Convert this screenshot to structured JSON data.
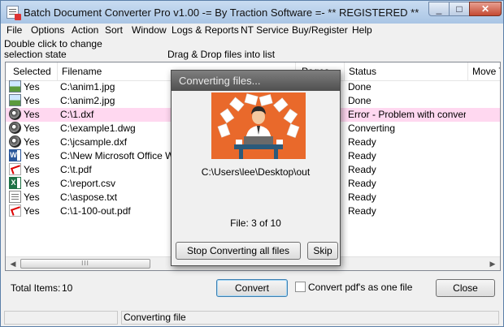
{
  "window": {
    "title": "Batch Document Converter Pro v1.00 -= By Traction Software =- ** REGISTERED **",
    "buttons": {
      "minimize": "_",
      "maximize": "□",
      "close": "✕"
    }
  },
  "menu": [
    "File",
    "Options",
    "Action",
    "Sort",
    "Window",
    "Logs & Reports",
    "NT Service",
    "Buy/Register",
    "Help"
  ],
  "hints": {
    "double_click_line1": "Double click to change",
    "double_click_line2": "selection state",
    "drag_drop": "Drag & Drop files into list"
  },
  "list": {
    "columns": [
      "Selected",
      "Filename",
      "Pages",
      "Status",
      "Move T"
    ],
    "rows": [
      {
        "icon": "image-file-icon",
        "selected": "Yes",
        "filename": "C:\\anim1.jpg",
        "status": "Done"
      },
      {
        "icon": "image-file-icon",
        "selected": "Yes",
        "filename": "C:\\anim2.jpg",
        "status": "Done"
      },
      {
        "icon": "cad-file-icon",
        "selected": "Yes",
        "filename": "C:\\1.dxf",
        "status": "Error - Problem with conver...",
        "error": true
      },
      {
        "icon": "cad-file-icon",
        "selected": "Yes",
        "filename": "C:\\example1.dwg",
        "status": "Converting"
      },
      {
        "icon": "cad-file-icon",
        "selected": "Yes",
        "filename": "C:\\jcsample.dxf",
        "status": "Ready"
      },
      {
        "icon": "word-file-icon",
        "selected": "Yes",
        "filename": "C:\\New Microsoft Office Wor",
        "status": "Ready"
      },
      {
        "icon": "pdf-file-icon",
        "selected": "Yes",
        "filename": "C:\\t.pdf",
        "status": "Ready"
      },
      {
        "icon": "excel-file-icon",
        "selected": "Yes",
        "filename": "C:\\report.csv",
        "status": "Ready"
      },
      {
        "icon": "text-file-icon",
        "selected": "Yes",
        "filename": "C:\\aspose.txt",
        "status": "Ready"
      },
      {
        "icon": "pdf-file-icon",
        "selected": "Yes",
        "filename": "C:\\1-100-out.pdf",
        "status": "Ready"
      }
    ],
    "scroll_thumb_grip": "III"
  },
  "footer": {
    "total_items_label": "Total Items:",
    "total_items_value": "10",
    "convert_button": "Convert",
    "convert_pdfs_label": "Convert pdf's as one file",
    "close_button": "Close"
  },
  "statusbar": {
    "panel1": "",
    "panel2": "Converting file"
  },
  "dialog": {
    "title": "Converting files...",
    "output_path": "C:\\Users\\lee\\Desktop\\out",
    "progress_text": "File: 3 of 10",
    "stop_button": "Stop Converting all files",
    "skip_button": "Skip"
  },
  "colors": {
    "error_row": "#ffd8f0",
    "dialog_title_bar": "#5f5f5f",
    "illustration_bg": "#e9692b",
    "titlebar": "#b8d0ec"
  }
}
